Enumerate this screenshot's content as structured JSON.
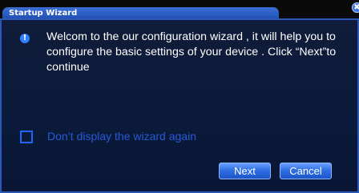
{
  "window": {
    "title": "Startup Wizard",
    "close_glyph": "✖"
  },
  "content": {
    "info_icon_glyph": "!",
    "message": "Welcom to the our configuration wizard , it will help you to configure the basic settings of your device . Click “Next”to continue",
    "checkbox_label": "Don’t display the wizard again",
    "checkbox_checked": false
  },
  "buttons": {
    "next_label": "Next",
    "cancel_label": "Cancel"
  },
  "colors": {
    "accent": "#2f6fe4",
    "background": "#0b1a3a",
    "text": "#ffffff",
    "checkbox_label": "#245ad8"
  }
}
